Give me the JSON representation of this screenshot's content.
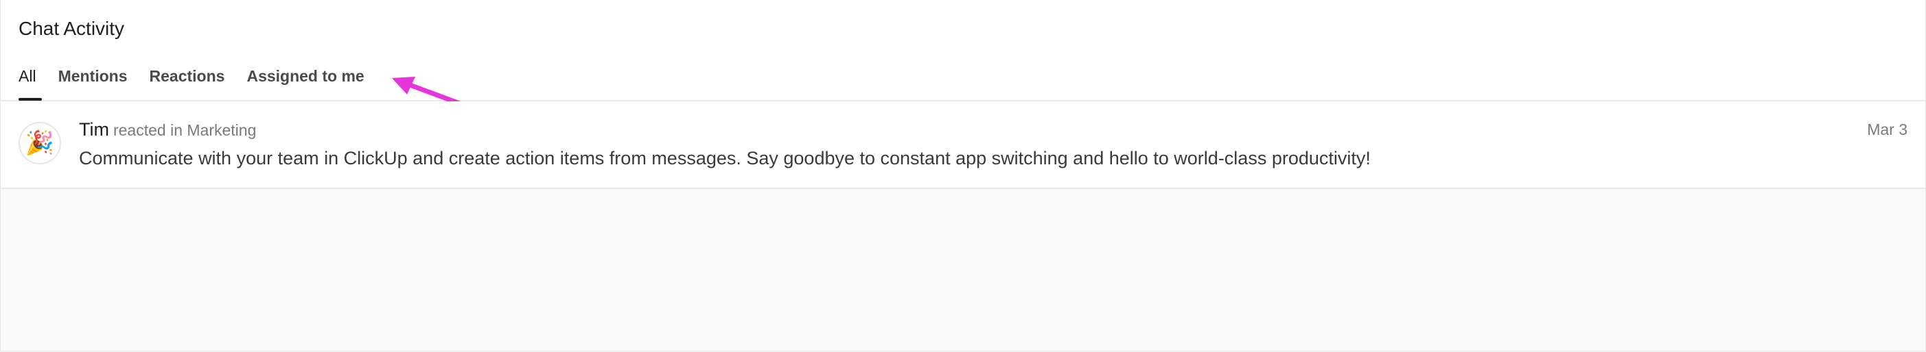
{
  "header": {
    "title": "Chat Activity",
    "tabs": [
      {
        "label": "All",
        "active": true
      },
      {
        "label": "Mentions",
        "active": false
      },
      {
        "label": "Reactions",
        "active": false
      },
      {
        "label": "Assigned to me",
        "active": false
      }
    ]
  },
  "annotation": {
    "arrow_color": "#e635d8",
    "points_to": "Assigned to me"
  },
  "activity": [
    {
      "avatar_icon": "party-popper-icon",
      "avatar_glyph": "🎉",
      "user": "Tim",
      "action": "reacted in Marketing",
      "date": "Mar 3",
      "message": "Communicate with your team in ClickUp and create action items from messages. Say goodbye to constant app switching and hello to world-class productivity!"
    }
  ]
}
